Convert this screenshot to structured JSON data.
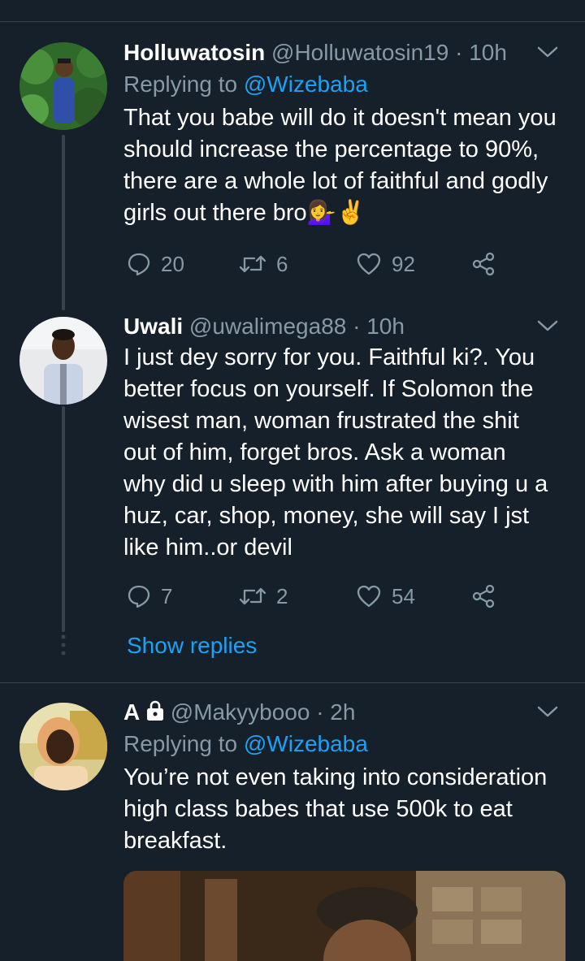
{
  "tweets": [
    {
      "name": "Holluwatosin",
      "handle": "@Holluwatosin19",
      "separator": "·",
      "time": "10h",
      "replying_prefix": "Replying to",
      "replying_to": "@Wizebaba",
      "lines": [
        "That you babe will do it doesn't mean you",
        "should increase the percentage to 90%,",
        "there are a whole lot of faithful and godly",
        "girls out there bro💁‍♀️✌️"
      ],
      "reply_count": "20",
      "retweet_count": "6",
      "like_count": "92"
    },
    {
      "name": "Uwali",
      "handle": "@uwalimega88",
      "separator": "·",
      "time": "10h",
      "lines": [
        "I just dey sorry for you. Faithful ki?. You",
        "better focus on yourself. If Solomon the",
        "wisest man, woman frustrated the shit",
        "out of him, forget bros. Ask a woman",
        "why did u sleep with him after buying u a",
        "huz, car, shop, money, she will say I jst",
        "like him..or devil"
      ],
      "reply_count": "7",
      "retweet_count": "2",
      "like_count": "54",
      "show_replies": "Show replies"
    },
    {
      "name": "A",
      "handle": "@Makyybooo",
      "separator": "·",
      "time": "2h",
      "replying_prefix": "Replying to",
      "replying_to": "@Wizebaba",
      "lines": [
        "You’re not even taking into consideration",
        "high class babes that use 500k to eat",
        "breakfast."
      ]
    }
  ],
  "icons": {
    "reply": "reply-icon",
    "retweet": "retweet-icon",
    "like": "heart-icon",
    "share": "share-icon",
    "caret": "chevron-down-icon",
    "lock": "lock-icon"
  },
  "colors": {
    "background": "#15202b",
    "secondary_text": "#8899a6",
    "accent": "#1da1f2",
    "divider": "#38444d"
  }
}
